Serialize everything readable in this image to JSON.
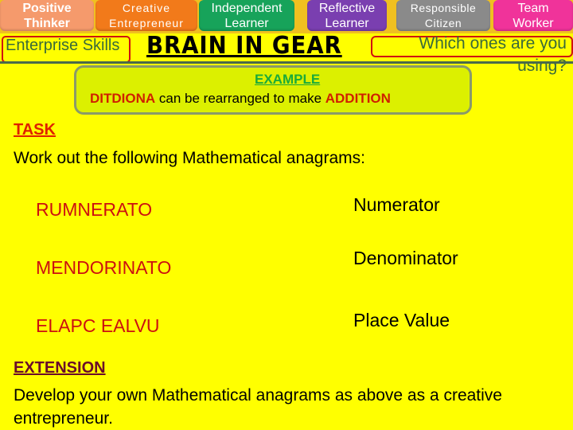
{
  "skills_bar": {
    "tabs": [
      {
        "line1": "Positive",
        "line2": "Thinker",
        "color": "#f59a6c"
      },
      {
        "line1": "Creative",
        "line2": "Entrepreneur",
        "color": "#f27a1a"
      },
      {
        "line1": "Independent",
        "line2": "Learner",
        "color": "#17a35a"
      },
      {
        "line1": "Reflective",
        "line2": "Learner",
        "color": "#7a3fb0"
      },
      {
        "line1": "Responsible",
        "line2": "Citizen",
        "color": "#8a8a8a"
      },
      {
        "line1": "Team",
        "line2": "Worker",
        "color": "#f0339a"
      }
    ]
  },
  "header": {
    "enterprise_label": "Enterprise Skills",
    "title": "BRAIN IN GEAR",
    "question_line1": "Which ones are you",
    "question_line2": "using?"
  },
  "example": {
    "heading": "EXAMPLE",
    "scrambled": "DITDIONA",
    "middle": " can be rearranged to make ",
    "answer": "ADDITION"
  },
  "task": {
    "heading": "TASK",
    "instruction": "Work out the following Mathematical anagrams:",
    "anagrams": [
      {
        "scrambled": "RUMNERATO",
        "answer": "Numerator"
      },
      {
        "scrambled": "MENDORINATO",
        "answer": "Denominator"
      },
      {
        "scrambled": "ELAPC EALVU",
        "answer": "Place Value"
      }
    ]
  },
  "extension": {
    "heading": "EXTENSION",
    "text": "Develop your own Mathematical anagrams as above as a creative entrepreneur."
  },
  "colors": {
    "background": "#ffff00",
    "highlight_red": "#d02000",
    "example_green": "#1aaa3a"
  }
}
